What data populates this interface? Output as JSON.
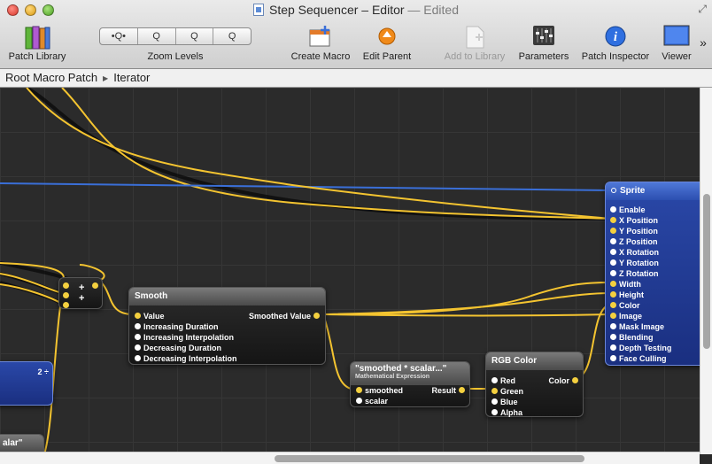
{
  "window": {
    "title": "Step Sequencer – Editor",
    "edited": "— Edited",
    "fullscreen_icon": "fullscreen-icon"
  },
  "toolbar": {
    "patch_library": "Patch Library",
    "zoom_levels": "Zoom Levels",
    "zoom_buttons": [
      "•Q•",
      "Q",
      "Q",
      "Q"
    ],
    "create_macro": "Create Macro",
    "edit_parent": "Edit Parent",
    "add_to_library": "Add to Library",
    "parameters": "Parameters",
    "patch_inspector": "Patch Inspector",
    "viewer": "Viewer",
    "overflow": "»"
  },
  "breadcrumb": {
    "root": "Root Macro Patch",
    "sep": "▶",
    "current": "Iterator"
  },
  "patches": {
    "sprite": {
      "title": "Sprite",
      "inputs": [
        "Enable",
        "X Position",
        "Y Position",
        "Z Position",
        "X Rotation",
        "Y Rotation",
        "Z Rotation",
        "Width",
        "Height",
        "Color",
        "Image",
        "Mask Image",
        "Blending",
        "Depth Testing",
        "Face Culling"
      ]
    },
    "smooth": {
      "title": "Smooth",
      "inputs": [
        "Value",
        "Increasing Duration",
        "Increasing Interpolation",
        "Decreasing Duration",
        "Decreasing Interpolation"
      ],
      "output": "Smoothed Value"
    },
    "math": {
      "title": "\"smoothed * scalar...\"",
      "subtitle": "Mathematical Expression",
      "inputs": [
        "smoothed",
        "scalar"
      ],
      "output": "Result"
    },
    "rgb": {
      "title": "RGB Color",
      "inputs": [
        "Red",
        "Green",
        "Blue",
        "Alpha"
      ],
      "output": "Color"
    },
    "adder": {
      "plus1": "+",
      "plus2": "+"
    },
    "left_blue": {
      "value": "2 ÷"
    },
    "left_dark": {
      "title": "alar\""
    }
  },
  "colors": {
    "wire_yellow": "#f4c430",
    "wire_blue": "#3a6fd8",
    "sprite_blue": "#2a48a8"
  }
}
